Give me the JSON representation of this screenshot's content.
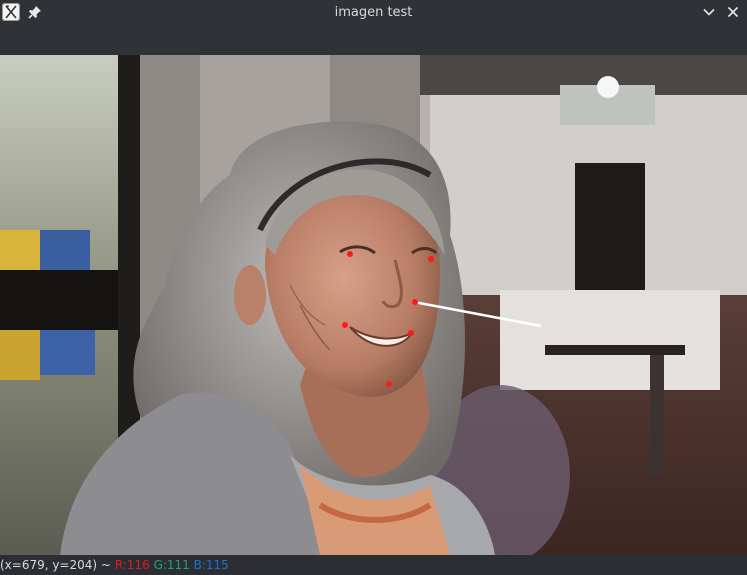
{
  "window": {
    "title": "imagen test",
    "app_icon": "x-letter-app-icon",
    "pin_icon": "pin-icon",
    "minimize_icon": "chevron-down-icon",
    "close_icon": "close-icon"
  },
  "image": {
    "description_icon": "photo-canvas",
    "landmarks_color": "#ff1a1a",
    "pose_line_color": "#ffffff"
  },
  "statusbar": {
    "coords": "(x=679, y=204) ~",
    "r_label": "R:116",
    "g_label": "G:111",
    "b_label": "B:115",
    "r_color": "#e01b24",
    "g_color": "#26a269",
    "b_color": "#1c71d8"
  }
}
